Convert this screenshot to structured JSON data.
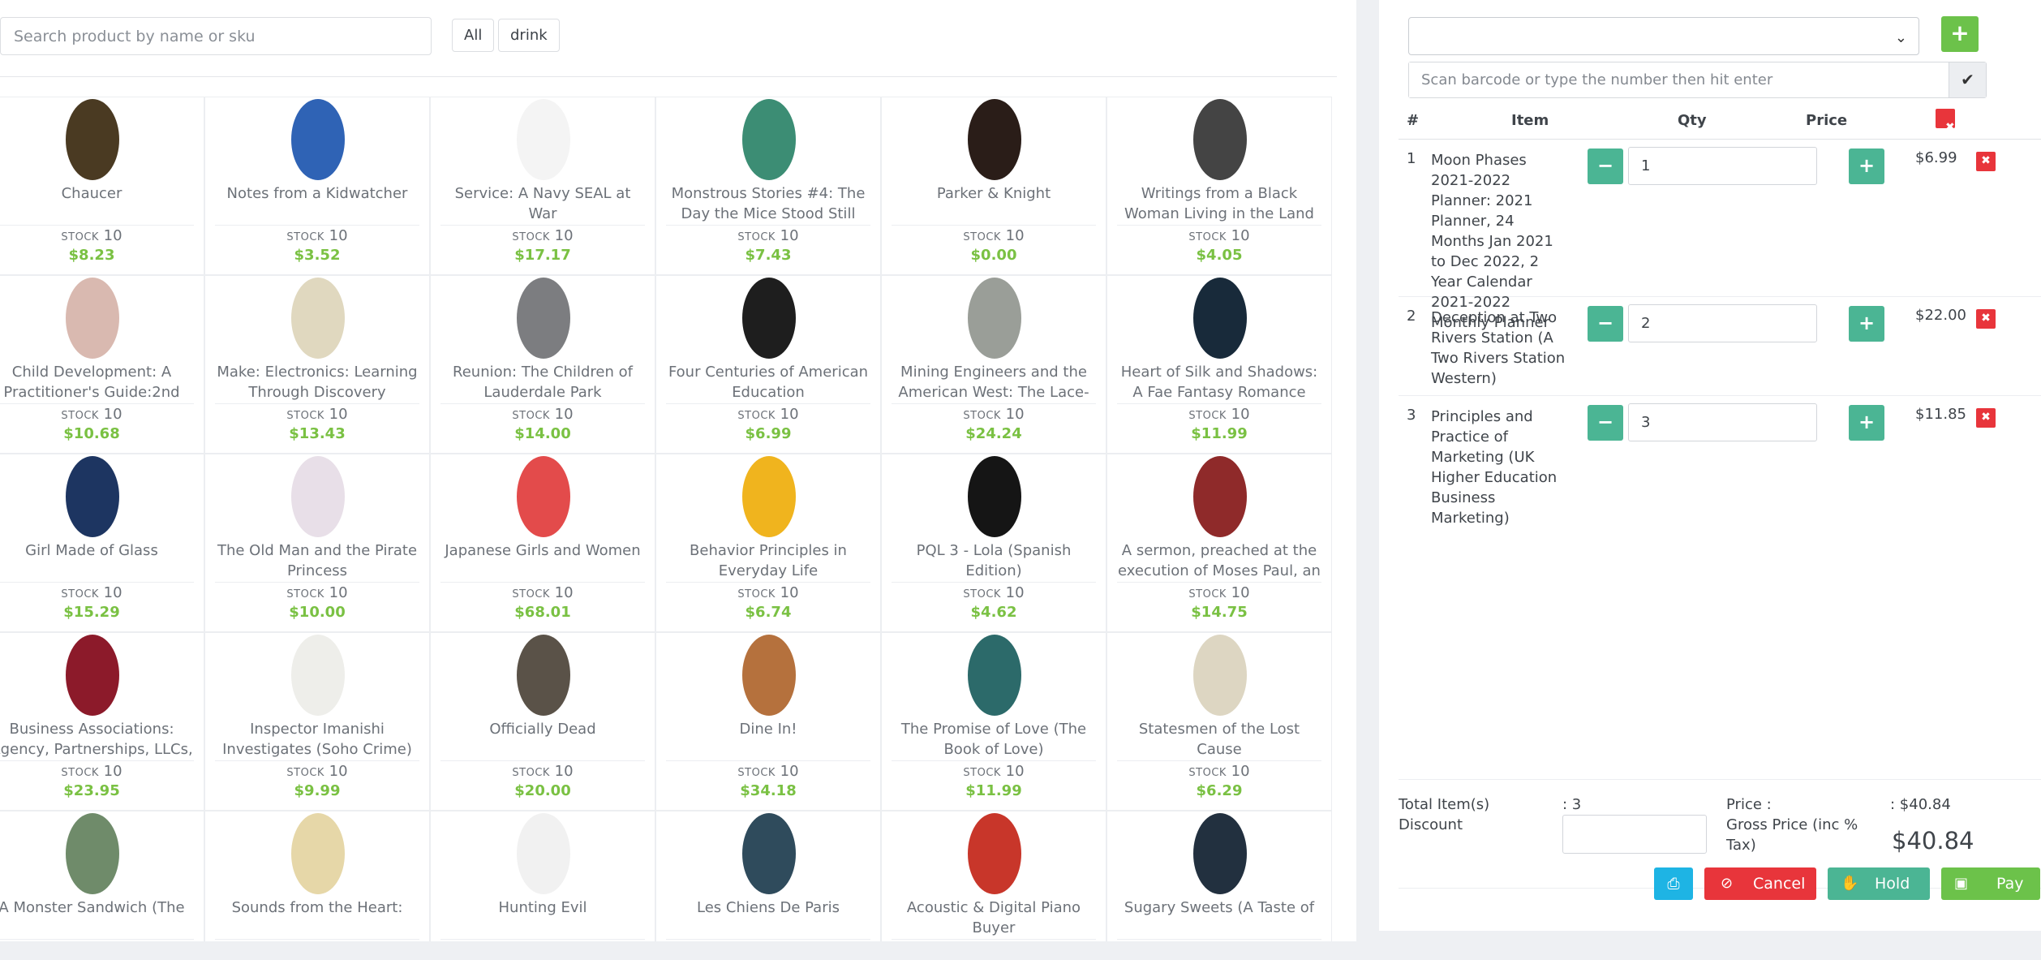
{
  "search": {
    "placeholder": "Search product by name or sku"
  },
  "categories": [
    {
      "label": "All"
    },
    {
      "label": "drink"
    }
  ],
  "stock_label": "STOCK",
  "products": [
    {
      "name": "Chaucer",
      "stock": "10",
      "price": "$8.23",
      "cover_color": "#4a3a22",
      "cover_text": "Chaucer"
    },
    {
      "name": "Notes from a Kidwatcher",
      "stock": "10",
      "price": "$3.52",
      "cover_color": "#2f63b5",
      "cover_text": ""
    },
    {
      "name": "Service: A Navy SEAL at War",
      "stock": "10",
      "price": "$17.17",
      "cover_color": "#f4f4f4",
      "cover_text": ""
    },
    {
      "name": "Monstrous Stories #4: The Day the Mice Stood Still",
      "stock": "10",
      "price": "$7.43",
      "cover_color": "#3c8d74",
      "cover_text": ""
    },
    {
      "name": "Parker & Knight",
      "stock": "10",
      "price": "$0.00",
      "cover_color": "#2a1d18",
      "cover_text": ""
    },
    {
      "name": "Writings from a Black Woman Living in the Land of the",
      "stock": "10",
      "price": "$4.05",
      "cover_color": "#444444",
      "cover_text": ""
    },
    {
      "name": "Child Development: A Practitioner's Guide:2nd",
      "stock": "10",
      "price": "$10.68",
      "cover_color": "#d9b9b0",
      "cover_text": ""
    },
    {
      "name": "Make: Electronics: Learning Through Discovery",
      "stock": "10",
      "price": "$13.43",
      "cover_color": "#e0d8bf",
      "cover_text": ""
    },
    {
      "name": "Reunion: The Children of Lauderdale Park",
      "stock": "10",
      "price": "$14.00",
      "cover_color": "#7c7d80",
      "cover_text": ""
    },
    {
      "name": "Four Centuries of American Education",
      "stock": "10",
      "price": "$6.99",
      "cover_color": "#1e1e1e",
      "cover_text": ""
    },
    {
      "name": "Mining Engineers and the American West: The Lace-Boot",
      "stock": "10",
      "price": "$24.24",
      "cover_color": "#9a9e98",
      "cover_text": ""
    },
    {
      "name": "Heart of Silk and Shadows: A Fae Fantasy Romance (Fae",
      "stock": "10",
      "price": "$11.99",
      "cover_color": "#182a3a",
      "cover_text": ""
    },
    {
      "name": "Girl Made of Glass",
      "stock": "10",
      "price": "$15.29",
      "cover_color": "#1d3561",
      "cover_text": ""
    },
    {
      "name": "The Old Man and the Pirate Princess",
      "stock": "10",
      "price": "$10.00",
      "cover_color": "#e8dfe8",
      "cover_text": ""
    },
    {
      "name": "Japanese Girls and Women",
      "stock": "10",
      "price": "$68.01",
      "cover_color": "#e34b4b",
      "cover_text": ""
    },
    {
      "name": "Behavior Principles in Everyday Life",
      "stock": "10",
      "price": "$6.74",
      "cover_color": "#f0b41e",
      "cover_text": ""
    },
    {
      "name": "PQL 3 - Lola (Spanish Edition)",
      "stock": "10",
      "price": "$4.62",
      "cover_color": "#151515",
      "cover_text": ""
    },
    {
      "name": "A sermon, preached at the execution of Moses Paul, an",
      "stock": "10",
      "price": "$14.75",
      "cover_color": "#8f2a2a",
      "cover_text": ""
    },
    {
      "name": "Business Associations: Agency, Partnerships, LLCs,",
      "stock": "10",
      "price": "$23.95",
      "cover_color": "#8c1a2a",
      "cover_text": ""
    },
    {
      "name": "Inspector Imanishi Investigates (Soho Crime)",
      "stock": "10",
      "price": "$9.99",
      "cover_color": "#eeeeea",
      "cover_text": ""
    },
    {
      "name": "Officially Dead",
      "stock": "10",
      "price": "$20.00",
      "cover_color": "#5a5248",
      "cover_text": ""
    },
    {
      "name": "Dine In!",
      "stock": "10",
      "price": "$34.18",
      "cover_color": "#b5713d",
      "cover_text": ""
    },
    {
      "name": "The Promise of Love (The Book of Love)",
      "stock": "10",
      "price": "$11.99",
      "cover_color": "#2c6a6a",
      "cover_text": ""
    },
    {
      "name": "Statesmen of the Lost Cause",
      "stock": "10",
      "price": "$6.29",
      "cover_color": "#ddd6c2",
      "cover_text": ""
    },
    {
      "name": "A Monster Sandwich (The",
      "stock": "",
      "price": "",
      "cover_color": "#6f8b6a",
      "cover_text": ""
    },
    {
      "name": "Sounds from the Heart:",
      "stock": "",
      "price": "",
      "cover_color": "#e6d7a8",
      "cover_text": ""
    },
    {
      "name": "Hunting Evil",
      "stock": "",
      "price": "",
      "cover_color": "#f1f1f1",
      "cover_text": ""
    },
    {
      "name": "Les Chiens De Paris",
      "stock": "",
      "price": "",
      "cover_color": "#2f4b5c",
      "cover_text": ""
    },
    {
      "name": "Acoustic & Digital Piano Buyer",
      "stock": "",
      "price": "",
      "cover_color": "#c8362a",
      "cover_text": ""
    },
    {
      "name": "Sugary Sweets (A Taste of",
      "stock": "",
      "price": "",
      "cover_color": "#22303f",
      "cover_text": ""
    }
  ],
  "customer_select": {
    "value": ""
  },
  "barcode": {
    "placeholder": "Scan barcode or type the number then hit enter"
  },
  "cart": {
    "headers": {
      "num": "#",
      "item": "Item",
      "qty": "Qty",
      "price": "Price"
    },
    "rows": [
      {
        "num": "1",
        "item": "Moon Phases 2021-2022 Planner: 2021 Planner, 24 Months Jan 2021 to Dec 2022, 2 Year Calendar 2021-2022 Monthly Planner",
        "qty": "1",
        "price": "$6.99"
      },
      {
        "num": "2",
        "item": "Deception at Two Rivers Station (A Two Rivers Station Western)",
        "qty": "2",
        "price": "$22.00"
      },
      {
        "num": "3",
        "item": "Principles and Practice of Marketing (UK Higher Education Business Marketing)",
        "qty": "3",
        "price": "$11.85"
      }
    ]
  },
  "totals": {
    "total_items_label": "Total Item(s)",
    "total_items_value": ": 3",
    "discount_label": "Discount",
    "price_label": "Price :",
    "price_value": ": $40.84",
    "gross_label": "Gross Price (inc % Tax)",
    "gross_value": "$40.84"
  },
  "actions": {
    "cancel": "Cancel",
    "hold": "Hold",
    "pay": "Pay"
  },
  "colors": {
    "accent_green": "#6cc24a",
    "teal": "#4bb594",
    "danger": "#e8353b",
    "info": "#1eb4e4",
    "price_green": "#7ac143"
  }
}
